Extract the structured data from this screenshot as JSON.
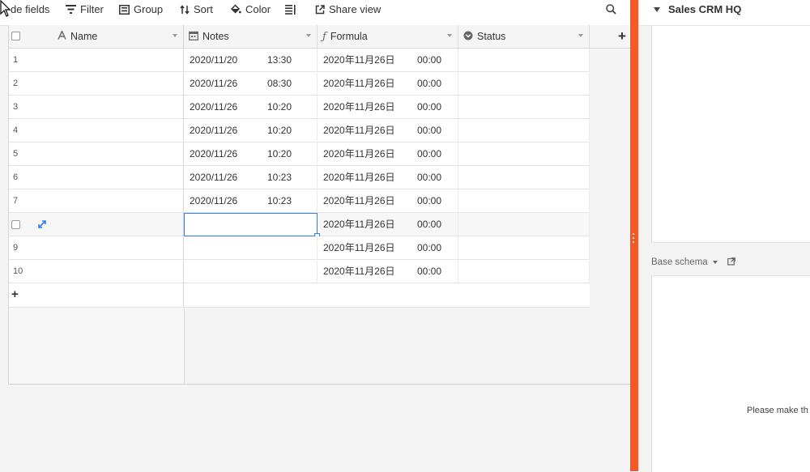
{
  "toolbar": {
    "hide_fields": "de fields",
    "filter": "Filter",
    "group": "Group",
    "sort": "Sort",
    "color": "Color",
    "share_view": "Share view"
  },
  "columns": {
    "name": "Name",
    "notes": "Notes",
    "formula": "Formula",
    "status": "Status"
  },
  "rows": [
    {
      "num": "1",
      "notes_date": "2020/11/20",
      "notes_time": "13:30",
      "formula_date": "2020年11月26日",
      "formula_time": "00:00"
    },
    {
      "num": "2",
      "notes_date": "2020/11/26",
      "notes_time": "08:30",
      "formula_date": "2020年11月26日",
      "formula_time": "00:00"
    },
    {
      "num": "3",
      "notes_date": "2020/11/26",
      "notes_time": "10:20",
      "formula_date": "2020年11月26日",
      "formula_time": "00:00"
    },
    {
      "num": "4",
      "notes_date": "2020/11/26",
      "notes_time": "10:20",
      "formula_date": "2020年11月26日",
      "formula_time": "00:00"
    },
    {
      "num": "5",
      "notes_date": "2020/11/26",
      "notes_time": "10:20",
      "formula_date": "2020年11月26日",
      "formula_time": "00:00"
    },
    {
      "num": "6",
      "notes_date": "2020/11/26",
      "notes_time": "10:23",
      "formula_date": "2020年11月26日",
      "formula_time": "00:00"
    },
    {
      "num": "7",
      "notes_date": "2020/11/26",
      "notes_time": "10:23",
      "formula_date": "2020年11月26日",
      "formula_time": "00:00"
    },
    {
      "num": "",
      "notes_date": "",
      "notes_time": "",
      "formula_date": "2020年11月26日",
      "formula_time": "00:00"
    },
    {
      "num": "9",
      "notes_date": "",
      "notes_time": "",
      "formula_date": "2020年11月26日",
      "formula_time": "00:00"
    },
    {
      "num": "10",
      "notes_date": "",
      "notes_time": "",
      "formula_date": "2020年11月26日",
      "formula_time": "00:00"
    }
  ],
  "add_row_label": "+",
  "add_field_label": "+",
  "right_panel": {
    "title": "Sales CRM HQ",
    "base_schema": "Base schema",
    "message": "Please make th"
  },
  "colors": {
    "accent_orange": "#f15a29",
    "selection_blue": "#2d7ff9"
  }
}
